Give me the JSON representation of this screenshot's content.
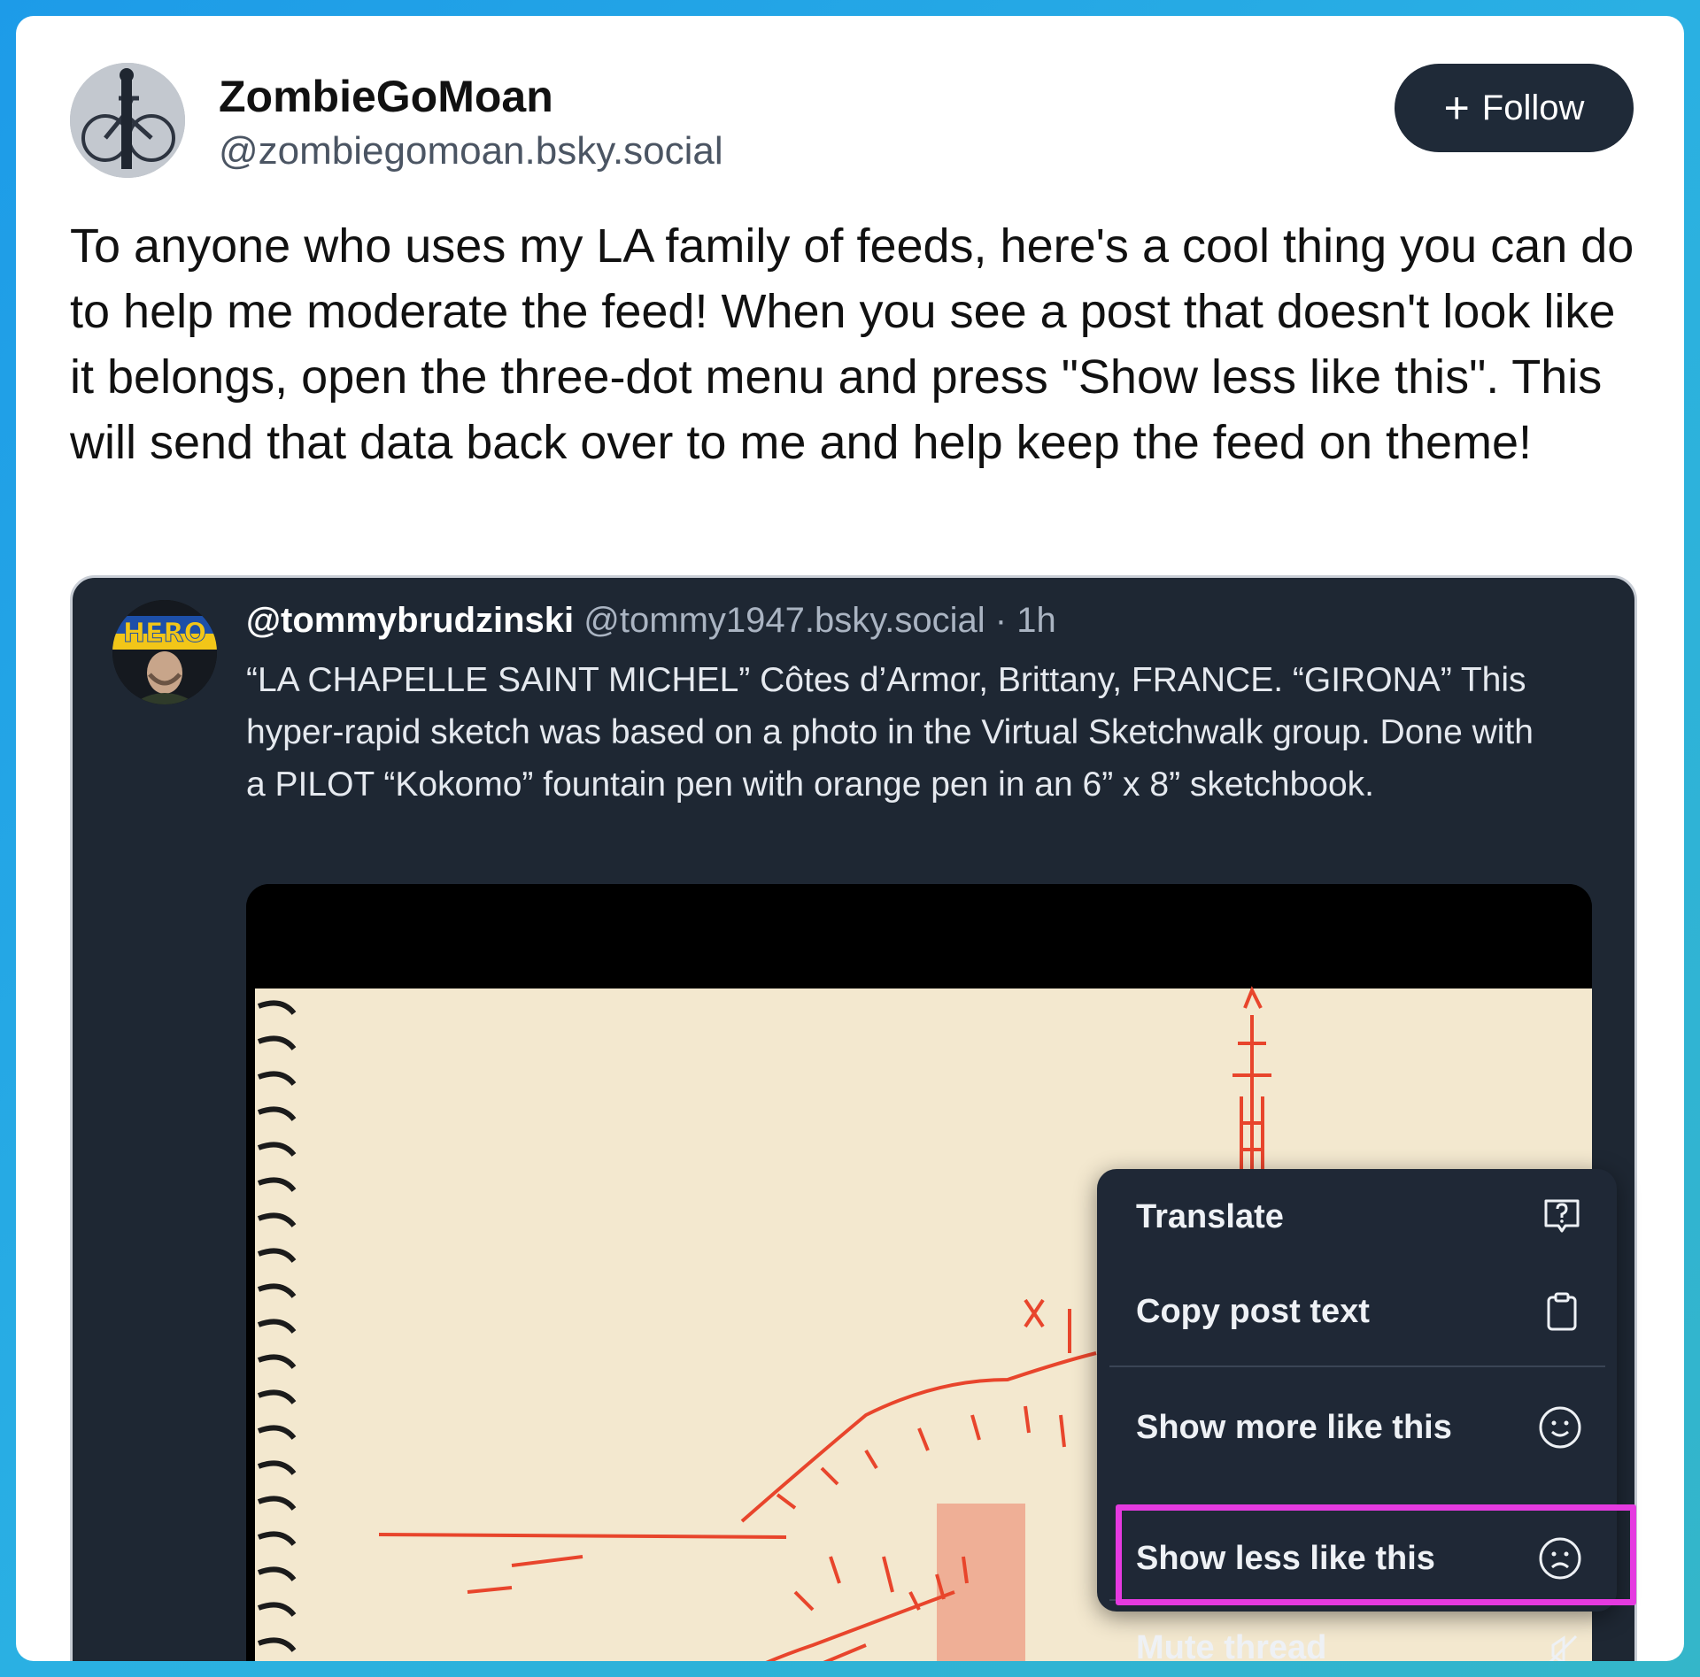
{
  "post": {
    "display_name": "ZombieGoMoan",
    "handle": "@zombiegomoan.bsky.social",
    "follow_icon": "plus-icon",
    "follow_label": "Follow",
    "text": "To anyone who uses my LA family of feeds, here's a cool thing you can do to help me moderate the feed! When you see a post that doesn't look like it belongs, open the three-dot menu and press \"Show less like this\". This will send that data back over to me and help keep the feed on theme!"
  },
  "quoted": {
    "avatar_text": "HERO",
    "username": "@tommybrudzinski",
    "handle": "@tommy1947.bsky.social",
    "separator": "·",
    "time": "1h",
    "text": "“LA CHAPELLE SAINT MICHEL” Côtes d’Armor, Brittany, FRANCE. “GIRONA” This hyper-rapid sketch was based on a photo in the Virtual Sketchwalk group. Done with a PILOT “Kokomo” fountain pen with orange  pen  in an 6” x 8” sketchbook."
  },
  "menu": {
    "items": [
      {
        "label": "Translate",
        "icon": "translate-icon"
      },
      {
        "label": "Copy post text",
        "icon": "clipboard-icon"
      },
      {
        "label": "Show more like this",
        "icon": "smile-icon"
      },
      {
        "label": "Show less like this",
        "icon": "frown-icon"
      },
      {
        "label": "Mute thread",
        "icon": "mute-icon"
      }
    ]
  },
  "colors": {
    "background_gradient": [
      "#1d9be8",
      "#34b6c9"
    ],
    "follow_button": "#1f2a38",
    "embed_background": "#1e2733",
    "menu_background": "#1f2836",
    "highlight": "#e53ae0",
    "sketch_ink": "#e8452c",
    "paper": "#f3e8cf"
  }
}
